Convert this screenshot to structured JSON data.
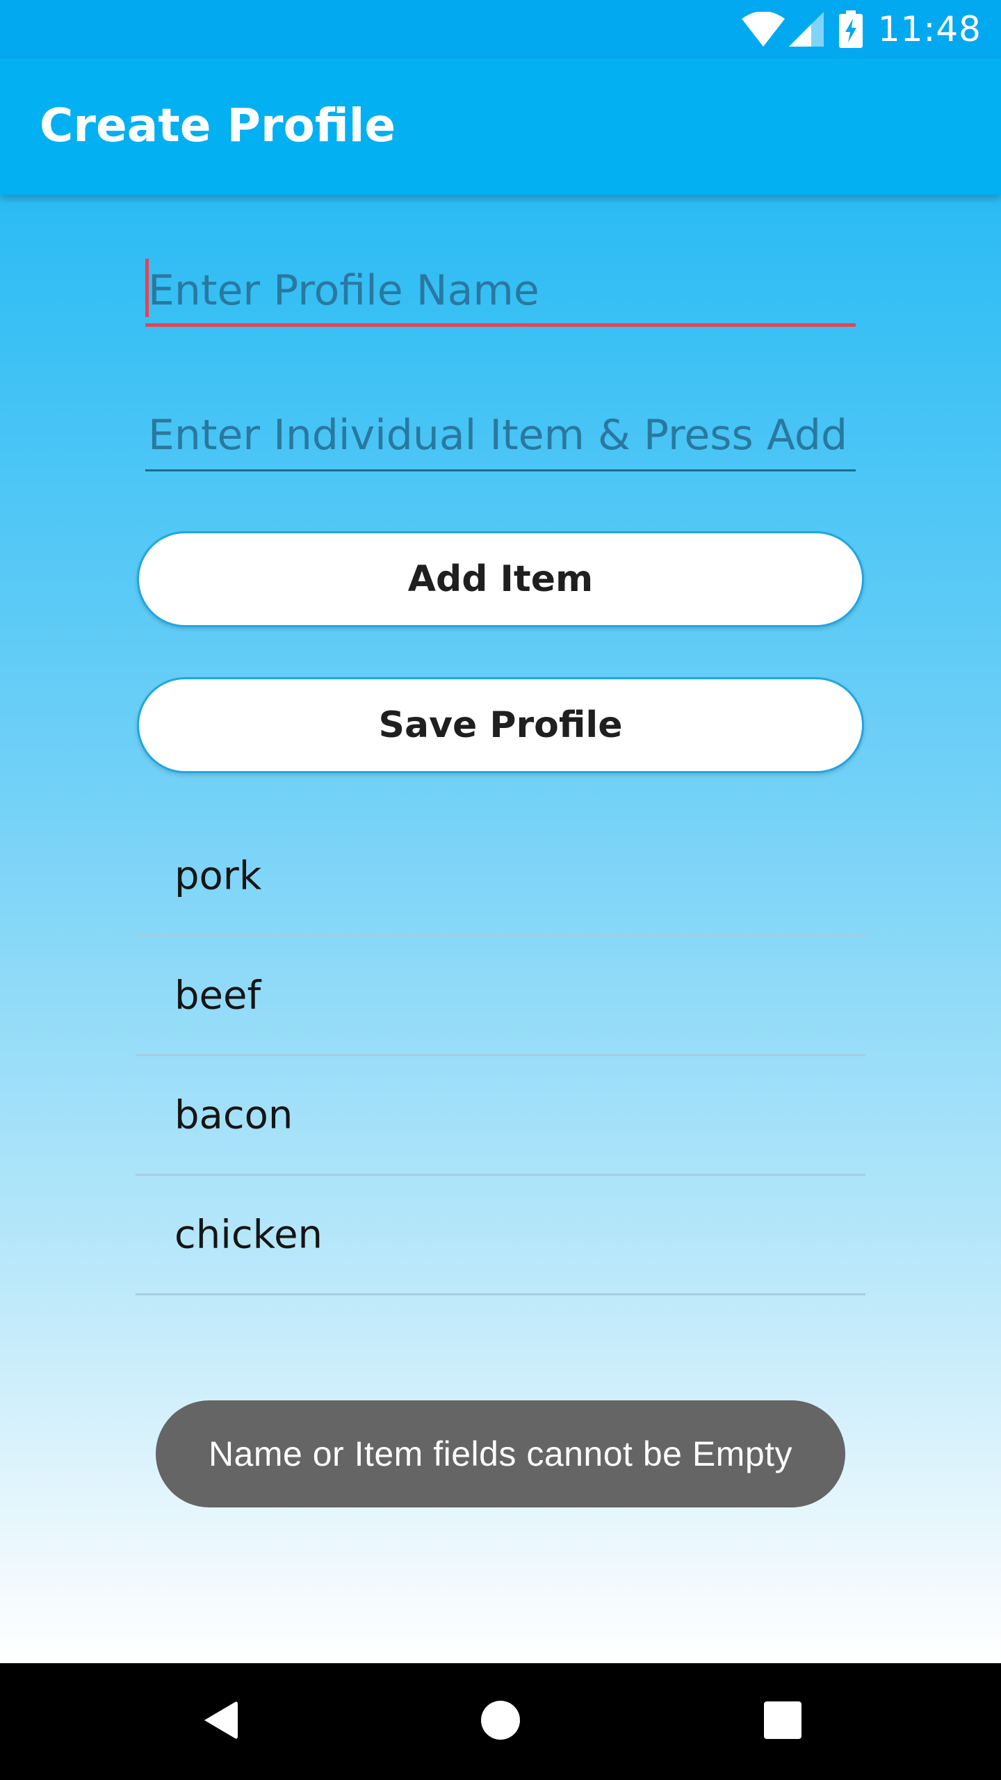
{
  "status_bar": {
    "time": "11:48",
    "icons": [
      "wifi-icon",
      "cell-signal-icon",
      "battery-charging-icon"
    ]
  },
  "app_bar": {
    "title": "Create Profile"
  },
  "form": {
    "profile_name_placeholder": "Enter Profile Name",
    "profile_name_value": "",
    "item_placeholder": "Enter Individual Item & Press Add",
    "item_value": "",
    "add_button_label": "Add Item",
    "save_button_label": "Save Profile"
  },
  "items": [
    {
      "label": "pork"
    },
    {
      "label": "beef"
    },
    {
      "label": "bacon"
    },
    {
      "label": "chicken"
    }
  ],
  "toast": {
    "message": "Name or Item fields cannot be Empty"
  },
  "nav_bar": {
    "buttons": [
      "back-icon",
      "home-icon",
      "recents-icon"
    ]
  },
  "colors": {
    "app_bar": "#03b0f1",
    "status_bar": "#03a9f0",
    "accent_error": "#e84351",
    "button_border": "#1ea6e3",
    "toast_bg": "#656565"
  }
}
